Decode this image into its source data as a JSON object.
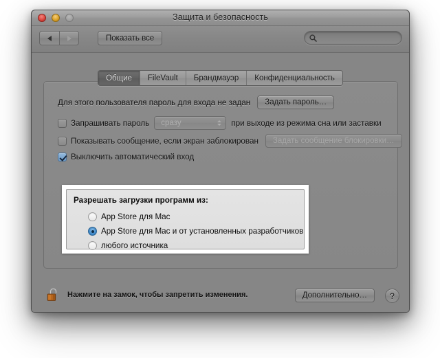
{
  "window": {
    "title": "Защита и безопасность",
    "traffic_lights": {
      "close": "close-button",
      "minimize": "minimize-button",
      "zoom": "zoom-button"
    }
  },
  "toolbar": {
    "back_label": "◀",
    "forward_label": "▶",
    "show_all_label": "Показать все",
    "search": {
      "value": "",
      "placeholder": ""
    }
  },
  "tabs": [
    {
      "label": "Общие",
      "active": true
    },
    {
      "label": "FileVault",
      "active": false
    },
    {
      "label": "Брандмауэр",
      "active": false
    },
    {
      "label": "Конфиденциальность",
      "active": false
    }
  ],
  "general": {
    "password_status": "Для этого пользователя пароль для входа не задан",
    "set_password_button": "Задать пароль…",
    "require_password": {
      "label": "Запрашивать пароль",
      "checked": false,
      "delay_value": "сразу",
      "suffix": "при выходе из режима сна или заставки"
    },
    "show_message": {
      "label": "Показывать сообщение, если экран заблокирован",
      "checked": false,
      "button": "Задать сообщение блокировки…",
      "button_disabled": true
    },
    "disable_auto_login": {
      "label": "Выключить автоматический вход",
      "checked": true
    }
  },
  "download_sources": {
    "title": "Разрешать загрузки программ из:",
    "options": [
      {
        "label": "App Store для Mac",
        "selected": false
      },
      {
        "label": "App Store для Mac и от установленных разработчиков",
        "selected": true
      },
      {
        "label": "любого источника",
        "selected": false
      }
    ]
  },
  "footer": {
    "lock_icon": "open-padlock-icon",
    "lock_text": "Нажмите на замок, чтобы запретить изменения.",
    "advanced_button": "Дополнительно…",
    "help_button": "?"
  },
  "colors": {
    "accent_blue": "#3c87c8",
    "highlight_frame": "#ffffff",
    "window_chrome": "#868686",
    "lock_body": "#b5651d"
  }
}
